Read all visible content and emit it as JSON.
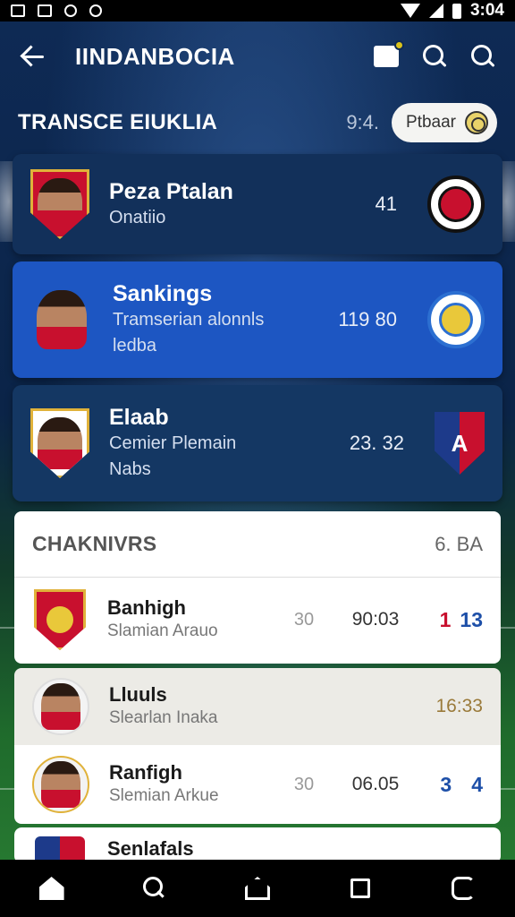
{
  "status_bar": {
    "time": "3:04"
  },
  "app_bar": {
    "title": "IINDANBOCIA"
  },
  "section": {
    "title": "TRANSCE EIUKLIA",
    "meta": "9:4.",
    "pill_label": "Ptbaar"
  },
  "transfers": [
    {
      "name": "Peza Ptalan",
      "subtitle": "Onatiio",
      "value": "41",
      "theme": "dark"
    },
    {
      "name": "Sankings",
      "subtitle": "Tramserian alonnls",
      "subtitle2": "ledba",
      "value": "119 80",
      "theme": "blue"
    },
    {
      "name": "Elaab",
      "subtitle": "Cemier Plemain",
      "subtitle2": "Nabs",
      "value": "23. 32",
      "theme": "mid"
    }
  ],
  "rankings": {
    "title": "CHAKNIVRS",
    "meta": "6. BA",
    "rows": [
      {
        "name": "Banhigh",
        "subtitle": "Slamian Arauo",
        "number": "30",
        "time": "90:03",
        "score_a": "1",
        "score_b": "13"
      }
    ]
  },
  "list": [
    {
      "name": "Lluuls",
      "subtitle": "Slearlan Inaka",
      "time": "16:33"
    },
    {
      "name": "Ranfigh",
      "subtitle": "Slemian Arkue",
      "number": "30",
      "time": "06.05",
      "score_a": "3",
      "score_b": "4"
    },
    {
      "name": "Senlafals"
    }
  ],
  "icons": {
    "back": "back-arrow-icon",
    "notifications": "notification-icon",
    "search": "search-icon",
    "nav": [
      "home-icon",
      "search-icon",
      "home-outline-icon",
      "square-icon",
      "swap-icon"
    ]
  },
  "colors": {
    "accent_blue": "#1d56c2",
    "score_red": "#c8102e",
    "score_blue": "#1d4fa8"
  }
}
